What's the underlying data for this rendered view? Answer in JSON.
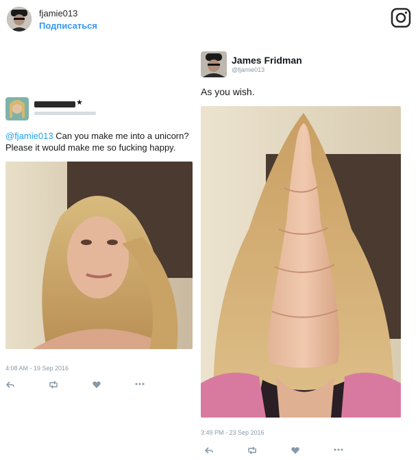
{
  "header": {
    "username": "fjamie013",
    "follow_label": "Подписаться"
  },
  "tweet_left": {
    "handle_line": "@fjamie013",
    "body": "Can you make me into a unicorn? Please it would make me so fucking happy.",
    "timestamp": "4:08 AM - 19 Sep 2016"
  },
  "tweet_right": {
    "name": "James Fridman",
    "handle": "@fjamie013",
    "body": "As you wish.",
    "timestamp": "3:49 PM - 23 Sep 2016"
  },
  "icons": [
    "instagram-icon",
    "reply-icon",
    "retweet-icon",
    "like-icon",
    "more-icon"
  ],
  "colors": {
    "link": "#3897f0",
    "mention": "#1da1f2",
    "meta": "#8899a6"
  }
}
